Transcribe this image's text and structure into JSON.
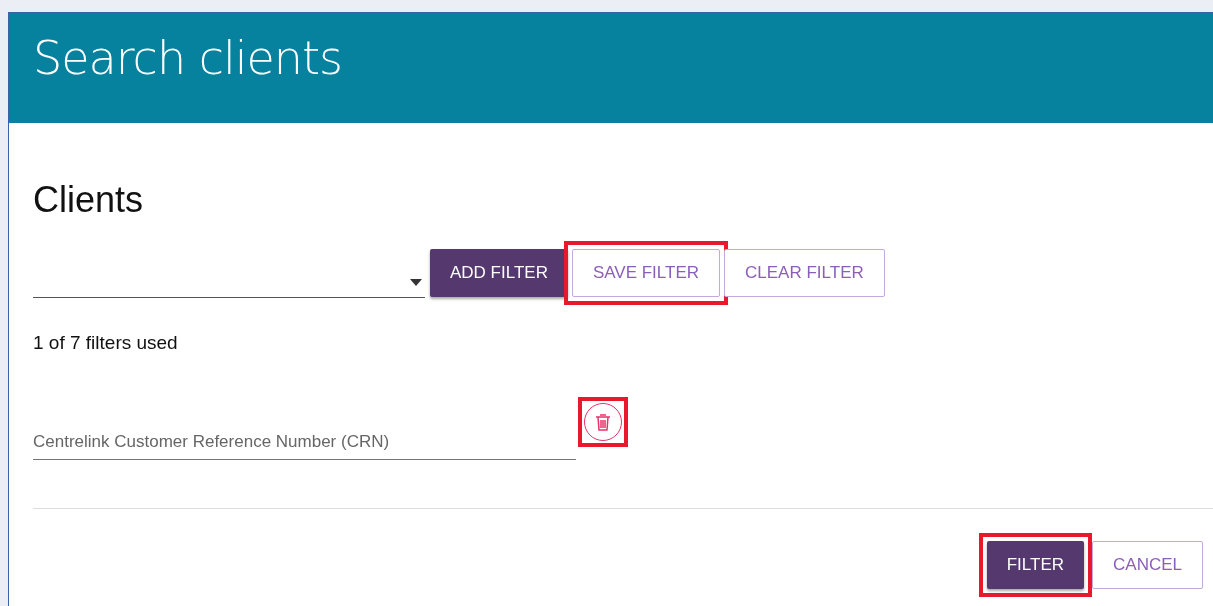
{
  "header": {
    "title": "Search clients"
  },
  "section": {
    "title": "Clients"
  },
  "filter_buttons": [
    {
      "label": "ADD FILTER",
      "kind": "primary",
      "highlighted": false
    },
    {
      "label": "SAVE FILTER",
      "kind": "outline",
      "highlighted": true
    },
    {
      "label": "CLEAR FILTER",
      "kind": "outline",
      "highlighted": false
    }
  ],
  "filters_used": "1 of 7 filters used",
  "filters": [
    {
      "placeholder": "Centrelink Customer Reference Number (CRN)",
      "delete_highlighted": true
    }
  ],
  "footer_buttons": [
    {
      "label": "FILTER",
      "kind": "primary",
      "highlighted": true
    },
    {
      "label": "CANCEL",
      "kind": "outline",
      "highlighted": false
    }
  ]
}
